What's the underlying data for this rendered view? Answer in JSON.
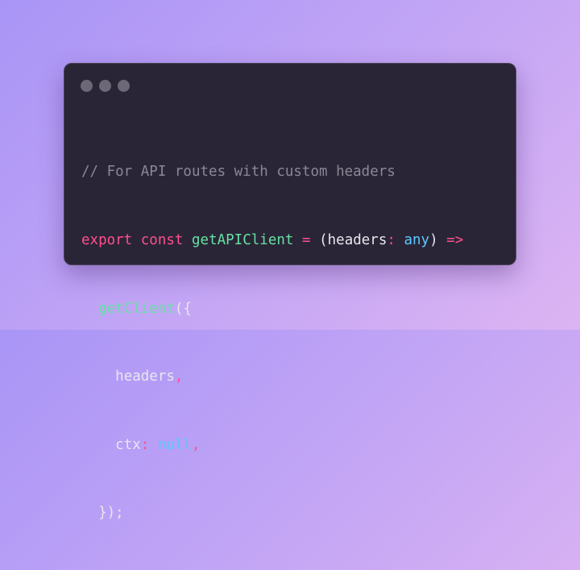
{
  "window": {
    "controls": [
      "window-dot",
      "window-dot",
      "window-dot"
    ]
  },
  "code": {
    "line1": "// For API routes with custom headers",
    "line2": {
      "kw_export": "export",
      "kw_const": "const",
      "fn_name": "getAPIClient",
      "eq": "=",
      "open_paren": "(",
      "param": "headers",
      "colon": ":",
      "type": "any",
      "close_paren": ")",
      "arrow": "=>"
    },
    "line3": {
      "fn_call": "getClient",
      "open": "({"
    },
    "line4": {
      "prop": "headers",
      "comma": ","
    },
    "line5": {
      "prop": "ctx",
      "colon": ":",
      "value": "null",
      "comma": ","
    },
    "line6": {
      "close": "});"
    }
  },
  "colors": {
    "keyword": "#ff4f8f",
    "function": "#66e0a3",
    "type": "#5cc8ff",
    "comment": "#8b8797",
    "text": "#e8e6ee",
    "window_bg": "#2a2536"
  }
}
